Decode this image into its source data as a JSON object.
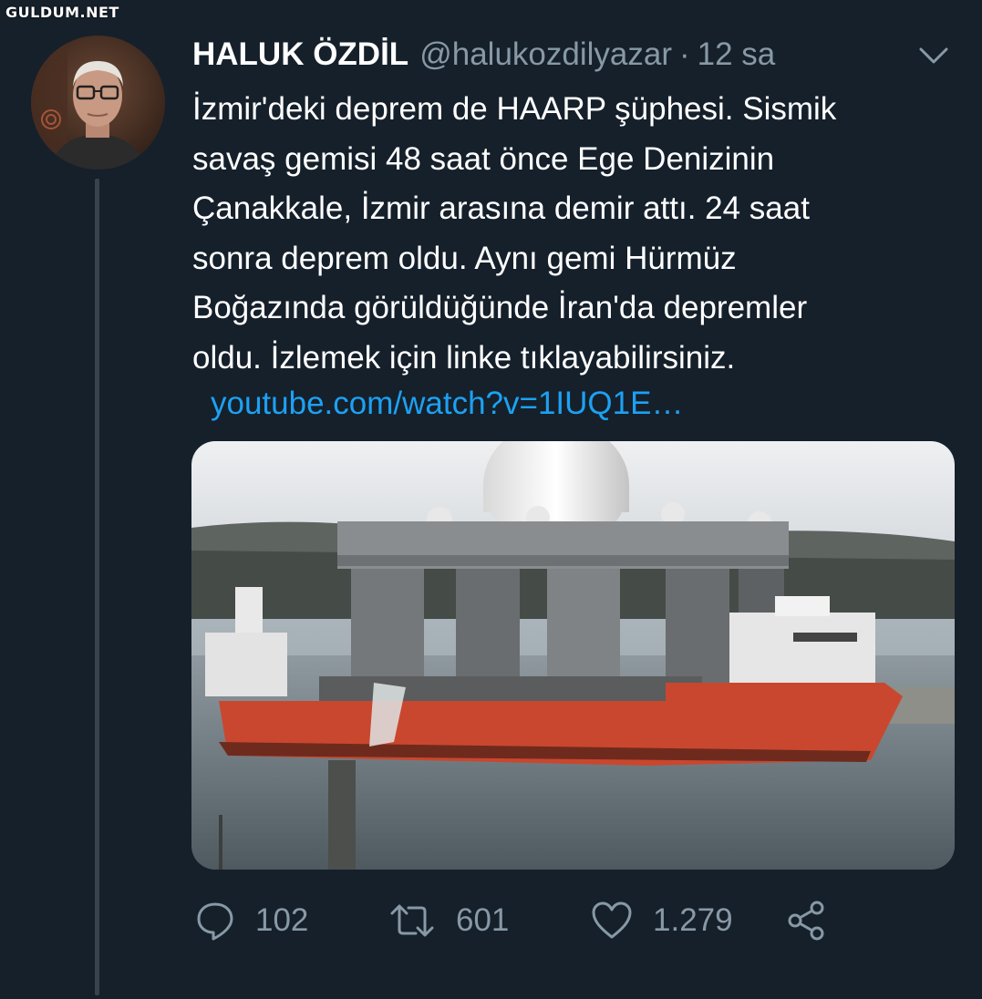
{
  "watermark": "GULDUM.NET",
  "tweet": {
    "author_name": "HALUK ÖZDİL",
    "handle": "@halukozdilyazar",
    "separator": "·",
    "time": "12 sa",
    "text_lines": [
      "İzmir'deki deprem de HAARP şüphesi. Sismik",
      "savaş gemisi 48 saat önce Ege Denizinin",
      "Çanakkale, İzmir arasına demir attı. 24 saat",
      "sonra deprem oldu. Aynı gemi Hürmüz",
      "Boğazında görüldüğünde İran'da depremler",
      "oldu. İzlemek için linke tıklayabilirsiniz."
    ],
    "link": "youtube.com/watch?v=1IUQ1E…"
  },
  "actions": {
    "reply_count": "102",
    "retweet_count": "601",
    "like_count": "1.279"
  },
  "colors": {
    "background": "#15202b",
    "secondary_text": "#8899a6",
    "link": "#1da1f2",
    "thread_line": "#38444d"
  },
  "icons": [
    "chevron-down-icon",
    "reply-icon",
    "retweet-icon",
    "like-icon",
    "share-icon"
  ]
}
